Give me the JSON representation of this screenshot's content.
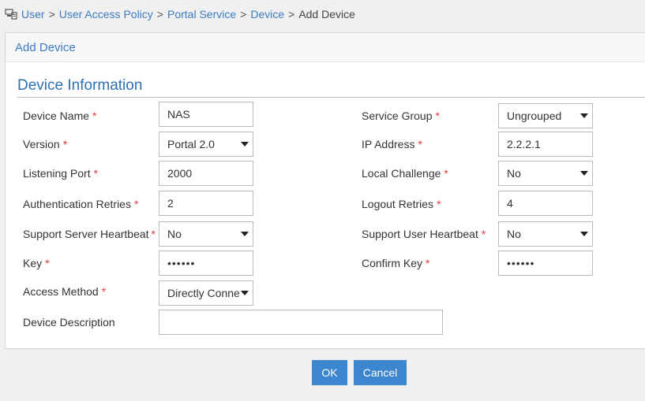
{
  "breadcrumb": {
    "items": [
      "User",
      "User Access Policy",
      "Portal Service",
      "Device"
    ],
    "separator": ">",
    "current": "Add Device"
  },
  "panel": {
    "title": "Add Device",
    "section_title": "Device Information"
  },
  "required_mark": "*",
  "form": {
    "device_name": {
      "label": "Device Name",
      "value": "NAS"
    },
    "version": {
      "label": "Version",
      "value": "Portal 2.0"
    },
    "listening_port": {
      "label": "Listening Port",
      "value": "2000"
    },
    "authentication_retries": {
      "label": "Authentication Retries",
      "value": "2"
    },
    "support_server_heartbeat": {
      "label": "Support Server Heartbeat",
      "value": "No"
    },
    "key": {
      "label": "Key",
      "value": "••••••"
    },
    "access_method": {
      "label": "Access Method",
      "value": "Directly Connected"
    },
    "device_description": {
      "label": "Device Description",
      "value": ""
    },
    "service_group": {
      "label": "Service Group",
      "value": "Ungrouped"
    },
    "ip_address": {
      "label": "IP Address",
      "value": "2.2.2.1"
    },
    "local_challenge": {
      "label": "Local Challenge",
      "value": "No"
    },
    "logout_retries": {
      "label": "Logout Retries",
      "value": "4"
    },
    "support_user_heartbeat": {
      "label": "Support User Heartbeat",
      "value": "No"
    },
    "confirm_key": {
      "label": "Confirm Key",
      "value": "••••••"
    }
  },
  "buttons": {
    "ok": "OK",
    "cancel": "Cancel"
  },
  "colors": {
    "link": "#3b7cc4",
    "primary_button": "#3c86cf",
    "required": "#e03a3a"
  }
}
